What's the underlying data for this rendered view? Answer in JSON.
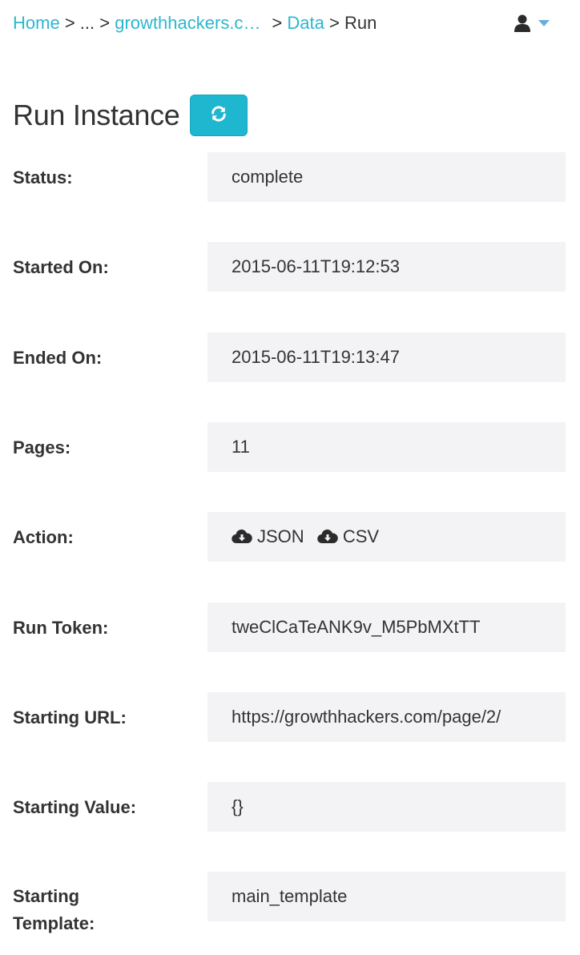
{
  "breadcrumb": {
    "home": "Home",
    "ellipsis": "...",
    "project": "growthhackers.com",
    "data": "Data",
    "current": "Run",
    "separator": ">"
  },
  "page": {
    "title": "Run Instance"
  },
  "fields": {
    "status": {
      "label": "Status:",
      "value": "complete"
    },
    "started_on": {
      "label": "Started On:",
      "value": "2015-06-11T19:12:53"
    },
    "ended_on": {
      "label": "Ended On:",
      "value": "2015-06-11T19:13:47"
    },
    "pages": {
      "label": "Pages:",
      "value": "11"
    },
    "action": {
      "label": "Action:",
      "json_label": "JSON",
      "csv_label": "CSV"
    },
    "run_token": {
      "label": "Run Token:",
      "value": "tweClCaTeANK9v_M5PbMXtTT"
    },
    "starting_url": {
      "label": "Starting URL:",
      "value": "https://growthhackers.com/page/2/"
    },
    "starting_value": {
      "label": "Starting Value:",
      "value": "{}"
    },
    "starting_template": {
      "label_line1": "Starting",
      "label_line2": "Template:",
      "value": "main_template"
    }
  },
  "colors": {
    "link": "#2bb7cf",
    "button": "#1fb6d0",
    "field_bg": "#f3f3f5",
    "text": "#333333"
  },
  "icons": {
    "refresh": "refresh-icon",
    "user": "user-icon",
    "caret": "caret-down-icon",
    "download": "cloud-download-icon"
  }
}
